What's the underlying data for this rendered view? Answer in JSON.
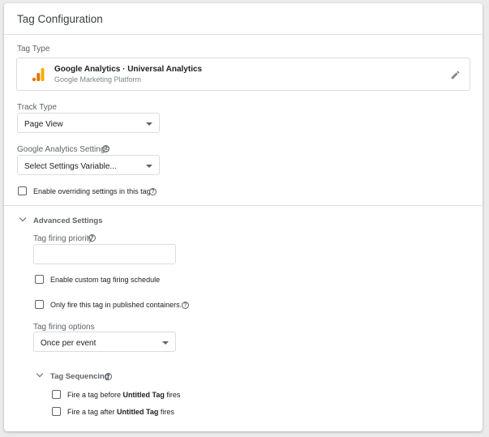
{
  "card": {
    "title": "Tag Configuration"
  },
  "tag_type": {
    "label": "Tag Type",
    "name": "Google Analytics · Universal Analytics",
    "subtitle": "Google Marketing Platform",
    "icon": "google-analytics-icon"
  },
  "track_type": {
    "label": "Track Type",
    "value": "Page View"
  },
  "ga_settings": {
    "label": "Google Analytics Settings",
    "value": "Select Settings Variable..."
  },
  "override": {
    "label": "Enable overriding settings in this tag",
    "checked": false
  },
  "advanced": {
    "label": "Advanced Settings",
    "priority": {
      "label": "Tag firing priority",
      "value": ""
    },
    "schedule": {
      "label": "Enable custom tag firing schedule",
      "checked": false
    },
    "published_only": {
      "label": "Only fire this tag in published containers.",
      "checked": false
    },
    "firing_options": {
      "label": "Tag firing options",
      "value": "Once per event"
    },
    "sequencing": {
      "label": "Tag Sequencing",
      "before": {
        "prefix": "Fire a tag before ",
        "tag": "Untitled Tag",
        "suffix": " fires",
        "checked": false
      },
      "after": {
        "prefix": "Fire a tag after ",
        "tag": "Untitled Tag",
        "suffix": " fires",
        "checked": false
      }
    }
  },
  "colors": {
    "ga_orange": "#f9ab00",
    "ga_dark_orange": "#e37400"
  }
}
